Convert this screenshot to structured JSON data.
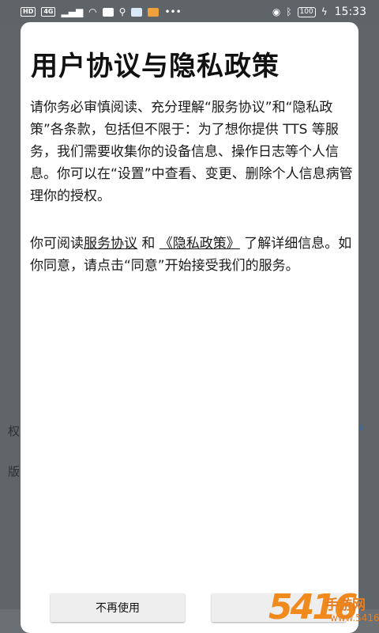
{
  "status_bar": {
    "left_chips": [
      "HD",
      "4G"
    ],
    "time": "15:33",
    "battery": "100",
    "icons": [
      "signal-icon",
      "wifi-icon",
      "app-notification-icon",
      "usb-icon",
      "shield-icon",
      "eye-icon",
      "bluetooth-icon",
      "battery-icon"
    ]
  },
  "background": {
    "label_1": "权",
    "label_2": "版",
    "chevron": "›"
  },
  "dialog": {
    "title": "用户协议与隐私政策",
    "paragraph_1": "请你务必审慎阅读、充分理解“服务协议”和“隐私政策”各条款，包括但不限于：为了想你提供 TTS 等服务，我们需要收集你的设备信息、操作日志等个人信息。你可以在“设置”中查看、变更、删除个人信息病管理你的授权。",
    "paragraph_2_prefix": "你可阅读",
    "service_agreement_link": "服务协议",
    "paragraph_2_and": " 和 ",
    "privacy_policy_link": "《隐私政策》",
    "paragraph_2_suffix": " 了解详细信息。如你同意，请点击“同意”开始接受我们的服务。",
    "decline_button": "不再使用",
    "agree_button": ""
  },
  "watermark": {
    "logo": "5416",
    "site": "手游网",
    "domain": "www.5416.cn"
  },
  "colors": {
    "overlay": "#5d6266",
    "dialog_bg": "#ffffff",
    "button_bg": "#eeeeee",
    "watermark_orange": "#f08a1c",
    "chevron_blue": "#2f6bb3"
  }
}
